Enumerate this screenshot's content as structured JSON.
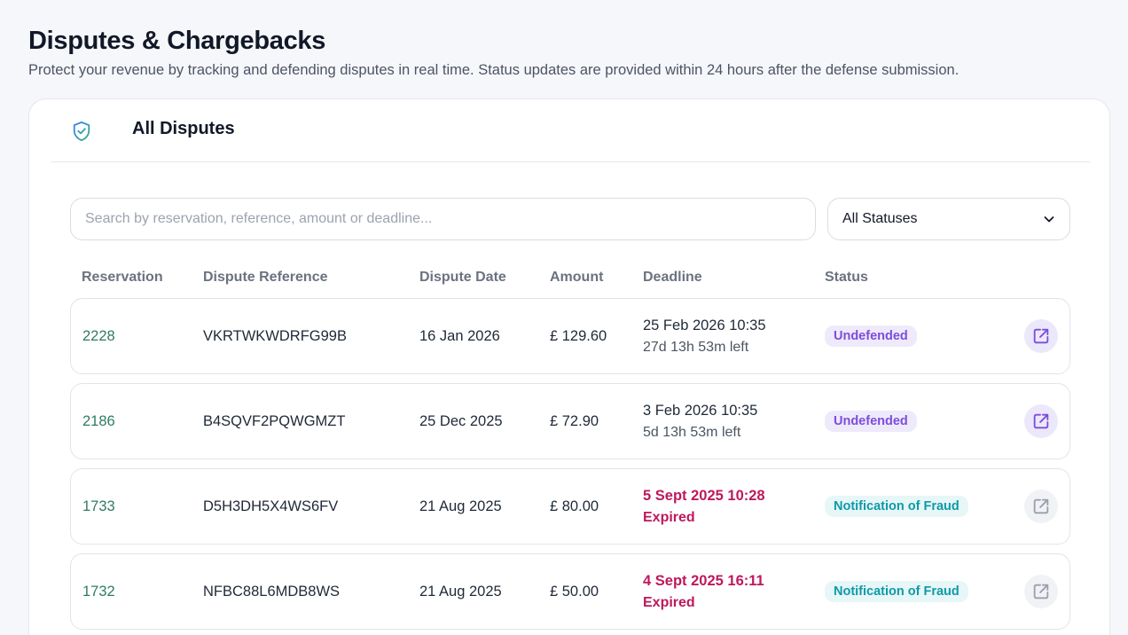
{
  "page": {
    "title": "Disputes & Chargebacks",
    "subtitle": "Protect your revenue by tracking and defending disputes in real time. Status updates are provided within 24 hours after the defense submission."
  },
  "card": {
    "title": "All Disputes",
    "icon": "shield-check-icon",
    "accent_color": "#3aa58a"
  },
  "filters": {
    "search_placeholder": "Search by reservation, reference, amount or deadline...",
    "search_value": "",
    "status_selected": "All Statuses"
  },
  "table": {
    "columns": [
      "Reservation",
      "Dispute Reference",
      "Dispute Date",
      "Amount",
      "Deadline",
      "Status"
    ],
    "rows": [
      {
        "reservation": "2228",
        "reference": "VKRTWKWDRFG99B",
        "date": "16 Jan 2026",
        "amount": "£ 129.60",
        "deadline": "25 Feb 2026 10:35",
        "deadline_note": "27d 13h 53m left",
        "expired": false,
        "status": "Undefended",
        "status_kind": "undefended",
        "action_icon": "external-link-icon"
      },
      {
        "reservation": "2186",
        "reference": "B4SQVF2PQWGMZT",
        "date": "25 Dec 2025",
        "amount": "£ 72.90",
        "deadline": "3 Feb 2026 10:35",
        "deadline_note": "5d 13h 53m left",
        "expired": false,
        "status": "Undefended",
        "status_kind": "undefended",
        "action_icon": "external-link-icon"
      },
      {
        "reservation": "1733",
        "reference": "D5H3DH5X4WS6FV",
        "date": "21 Aug 2025",
        "amount": "£ 80.00",
        "deadline": "5 Sept 2025 10:28",
        "deadline_note": "Expired",
        "expired": true,
        "status": "Notification of Fraud",
        "status_kind": "fraud",
        "action_icon": "external-link-icon"
      },
      {
        "reservation": "1732",
        "reference": "NFBC88L6MDB8WS",
        "date": "21 Aug 2025",
        "amount": "£ 50.00",
        "deadline": "4 Sept 2025 16:11",
        "deadline_note": "Expired",
        "expired": true,
        "status": "Notification of Fraud",
        "status_kind": "fraud",
        "action_icon": "external-link-icon"
      }
    ]
  },
  "colors": {
    "link": "#2f7d5f",
    "undefended_text": "#7c4ddb",
    "undefended_bg": "#efeafb",
    "fraud_text": "#0e9aa7",
    "fraud_bg": "#e7f6f7",
    "expired": "#be185d"
  }
}
